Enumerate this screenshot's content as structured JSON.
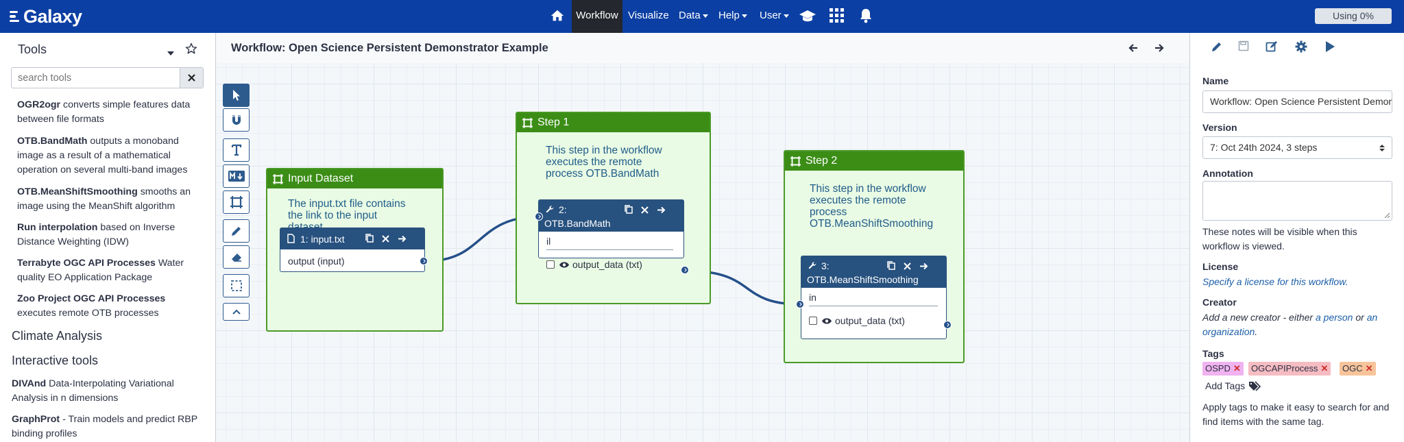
{
  "nav": {
    "brand": "Galaxy",
    "items": {
      "workflow": "Workflow",
      "visualize": "Visualize",
      "data": "Data",
      "help": "Help",
      "user": "User"
    },
    "usage": "Using 0%",
    "colors": {
      "nav_bg": "#0b3fa3",
      "active_bg": "#24272d"
    }
  },
  "tool_panel": {
    "title": "Tools",
    "search_placeholder": "search tools",
    "tools": [
      {
        "name": "OGR2ogr",
        "desc_1": " converts simple features data",
        "desc_2": "between file formats"
      },
      {
        "name": "OTB.BandMath",
        "desc_1": " outputs a monoband",
        "desc_2": "image as a result of a mathematical",
        "desc_3": "operation on several multi-band images"
      },
      {
        "name": "OTB.MeanShiftSmoothing",
        "desc_1": " smooths an",
        "desc_2": "image using the MeanShift algorithm"
      },
      {
        "name": "Run interpolation",
        "desc_1": " based on Inverse",
        "desc_2": "Distance Weighting (IDW)"
      },
      {
        "name": "Terrabyte OGC API Processes",
        "desc_1": " Water",
        "desc_2": "quality EO Application Package"
      },
      {
        "name": "Zoo Project OGC API Processes",
        "desc_1": "",
        "desc_2": "executes remote OTB processes"
      }
    ],
    "sections": {
      "climate": "Climate Analysis",
      "interactive": "Interactive tools"
    },
    "interactive_tools": [
      {
        "name": "DIVAnd",
        "desc_1": " Data-Interpolating Variational",
        "desc_2": "Analysis in n dimensions"
      },
      {
        "name": "GraphProt",
        "desc_1": " - Train models and predict RBP",
        "desc_2": "binding profiles"
      }
    ]
  },
  "workflow": {
    "title": "Workflow: Open Science Persistent Demonstrator Example",
    "frames": {
      "input": {
        "title": "Input Dataset",
        "text_1": "The input.txt file contains",
        "text_2": "the link to the input",
        "text_3": "dataset."
      },
      "step1": {
        "title": "Step 1",
        "text_1": "This step in the workflow",
        "text_2": "executes the remote",
        "text_3": "process OTB.BandMath"
      },
      "step2": {
        "title": "Step 2",
        "text_1": "This step in the workflow",
        "text_2": "executes the remote",
        "text_3": "process",
        "text_4": "OTB.MeanShiftSmoothing"
      }
    },
    "nodes": {
      "n1": {
        "title": "1: input.txt",
        "output": "output (input)"
      },
      "n2": {
        "number": "2:",
        "tool": "OTB.BandMath",
        "input": "il",
        "output": "output_data (txt)"
      },
      "n3": {
        "number": "3:",
        "tool": "OTB.MeanShiftSmoothing",
        "input": "in",
        "output": "output_data (txt)"
      }
    },
    "colors": {
      "frame_head": "#3b8d16",
      "frame_bg": "#e9fbe4",
      "node_head": "#27517e",
      "edge": "#25508a"
    }
  },
  "attributes": {
    "name_label": "Name",
    "name_value": "Workflow: Open Science Persistent Demonstrator Example",
    "version_label": "Version",
    "version_value": "7: Oct 24th 2024, 3 steps",
    "annotation_label": "Annotation",
    "annotation_help_1": "These notes will be visible when this",
    "annotation_help_2": "workflow is viewed.",
    "license_label": "License",
    "license_help": "Specify a license for this workflow.",
    "creator_label": "Creator",
    "creator_help_a": "Add a new creator - either ",
    "creator_link_person": "a person",
    "creator_help_or": " or ",
    "creator_link_an": "an",
    "creator_link_org": "organization",
    "creator_help_dot": ".",
    "tags_label": "Tags",
    "tags": [
      {
        "text": "OSPD",
        "color": "#f0b3f0"
      },
      {
        "text": "OGCAPIProcess",
        "color": "#f5bcc2"
      },
      {
        "text": "OGC",
        "color": "#f7c49a"
      }
    ],
    "add_tags": "Add Tags",
    "tags_help_1": "Apply tags to make it easy to search for and",
    "tags_help_2": "find items with the same tag."
  }
}
